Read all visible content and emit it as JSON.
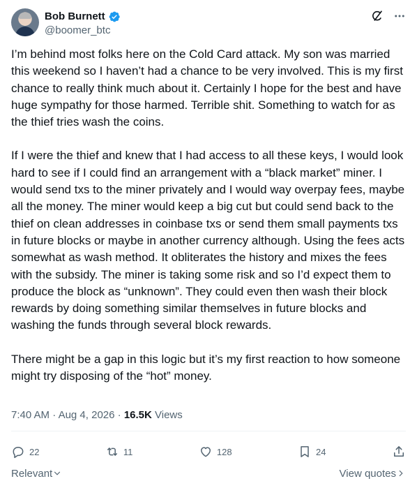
{
  "author": {
    "name": "Bob Burnett",
    "handle": "@boomer_btc",
    "verified": true
  },
  "post": {
    "paragraphs": [
      "I’m behind most folks here on the Cold Card attack.  My son was married this weekend so I haven’t had a chance to be very involved.  This is my first chance to really think much about it.  Certainly I hope for the best and have huge sympathy for those harmed.  Terrible shit.  Something to watch for as the thief tries wash the coins.",
      "If I were the thief and knew that I had access to all these keys, I would look hard to see if I could find an arrangement with a “black market” miner.   I would send txs to the miner privately and I would way overpay fees, maybe all the money.  The miner would keep a big cut but could send back to the thief on clean addresses in coinbase txs or send them small payments txs in future blocks or maybe in another currency although.  Using the fees acts somewhat as wash method.  It obliterates the history and mixes the fees with the subsidy.  The miner is taking some risk and so I’d expect them to produce the block as “unknown”.  They could even then wash their block rewards by doing something similar themselves in future blocks and washing the funds through several block rewards.",
      "There might be a gap in this logic but it’s my first reaction to how someone might try disposing of the “hot” money."
    ],
    "time": "7:40 AM",
    "separator": "·",
    "date": "Aug 4, 2026",
    "views_count": "16.5K",
    "views_label": "Views"
  },
  "actions": {
    "replies": "22",
    "reposts": "11",
    "likes": "128",
    "bookmarks": "24"
  },
  "footer": {
    "sort_label": "Relevant",
    "quotes_link": "View quotes"
  },
  "colors": {
    "text": "#0f1419",
    "secondary": "#536471",
    "verified_blue": "#1d9bf0",
    "divider": "#eff3f4"
  },
  "icons": [
    "verified-badge-icon",
    "grok-icon",
    "more-icon",
    "reply-icon",
    "repost-icon",
    "like-icon",
    "bookmark-icon",
    "share-icon",
    "chevron-down-icon",
    "chevron-right-icon"
  ]
}
